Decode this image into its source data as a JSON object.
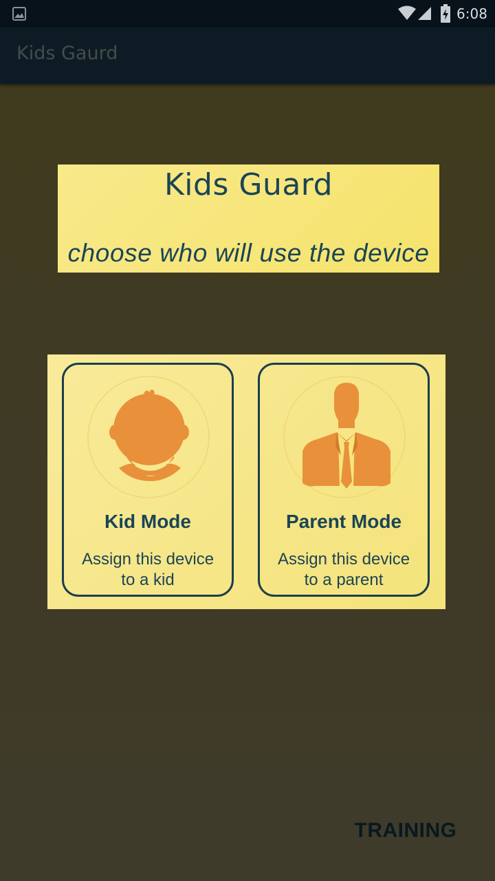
{
  "status_bar": {
    "time": "6:08",
    "icons": [
      "gallery-icon",
      "wifi-icon",
      "signal-icon",
      "battery-charging-icon"
    ]
  },
  "app_bar": {
    "title": "Kids Gaurd"
  },
  "banner": {
    "title": "Kids Guard",
    "subtitle": "choose who will use the device"
  },
  "modes": [
    {
      "title": "Kid Mode",
      "description_line1": "Assign this device",
      "description_line2": "to a kid",
      "icon": "kid-silhouette-icon"
    },
    {
      "title": "Parent Mode",
      "description_line1": "Assign this device",
      "description_line2": "to a parent",
      "icon": "parent-silhouette-icon"
    }
  ],
  "training": {
    "label": "TRAINING"
  },
  "colors": {
    "accent_text": "#1a4556",
    "card_background": "#f6e57e",
    "silhouette": "#e8913a",
    "screen_background": "#403b25"
  }
}
